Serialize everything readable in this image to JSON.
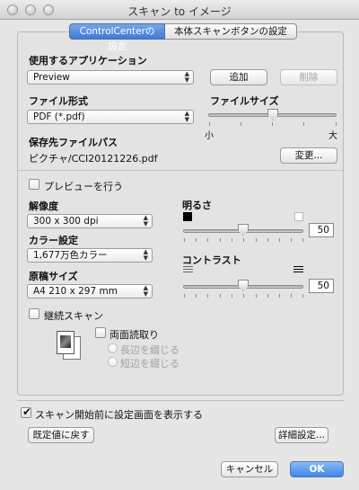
{
  "window": {
    "title": "スキャン to イメージ"
  },
  "tabs": [
    {
      "label": "ControlCenterの設定",
      "active": true
    },
    {
      "label": "本体スキャンボタンの設定",
      "active": false
    }
  ],
  "app": {
    "label": "使用するアプリケーション",
    "selected": "Preview",
    "add_label": "追加",
    "delete_label": "削除"
  },
  "file_format": {
    "label": "ファイル形式",
    "selected": "PDF (*.pdf)"
  },
  "file_size": {
    "label": "ファイルサイズ",
    "min_label": "小",
    "max_label": "大",
    "level": 0.5
  },
  "save_path": {
    "label": "保存先ファイルパス",
    "value": "ピクチャ/CCI20121226.pdf",
    "change_label": "変更..."
  },
  "preview": {
    "label": "プレビューを行う",
    "checked": false
  },
  "resolution": {
    "label": "解像度",
    "selected": "300 x 300 dpi"
  },
  "color": {
    "label": "カラー設定",
    "selected": "1,677万色カラー"
  },
  "doc_size": {
    "label": "原稿サイズ",
    "selected": "A4 210 x 297 mm"
  },
  "brightness": {
    "label": "明るさ",
    "value": "50"
  },
  "contrast": {
    "label": "コントラスト",
    "value": "50"
  },
  "continuous": {
    "label": "継続スキャン",
    "checked": false
  },
  "duplex": {
    "label": "両面読取り",
    "checked": false,
    "options": [
      "長辺を綴じる",
      "短辺を綴じる"
    ]
  },
  "show_settings": {
    "label": "スキャン開始前に設定画面を表示する",
    "checked": true
  },
  "buttons": {
    "restore": "既定値に戻す",
    "advanced": "詳細設定...",
    "cancel": "キャンセル",
    "ok": "OK"
  }
}
